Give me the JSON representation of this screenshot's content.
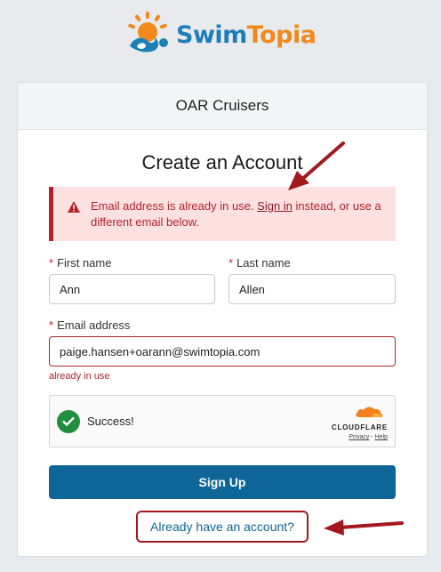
{
  "brand": {
    "name_part1": "Swim",
    "name_part2": "Topia",
    "colors": {
      "blue": "#1d7fb8",
      "orange": "#f08a1c"
    }
  },
  "card": {
    "header": "OAR Cruisers",
    "title": "Create an Account"
  },
  "alert": {
    "text_before": "Email address is already in use. ",
    "link": "Sign in",
    "text_after": " instead, or use a different email below.",
    "icon": "warning-icon"
  },
  "form": {
    "first_name": {
      "label": "First name",
      "value": "Ann"
    },
    "last_name": {
      "label": "Last name",
      "value": "Allen"
    },
    "email": {
      "label": "Email address",
      "value": "paige.hansen+oarann@swimtopia.com",
      "error": "already in use"
    },
    "required_marker": "*"
  },
  "captcha": {
    "status": "Success!",
    "provider": "CLOUDFLARE",
    "privacy": "Privacy",
    "separator": "·",
    "help": "Help"
  },
  "buttons": {
    "signup": "Sign Up",
    "already": "Already have an account?"
  },
  "colors": {
    "primary": "#0e6597",
    "error": "#b3232b",
    "success": "#1f8f3e",
    "annotation": "#a3181f"
  }
}
